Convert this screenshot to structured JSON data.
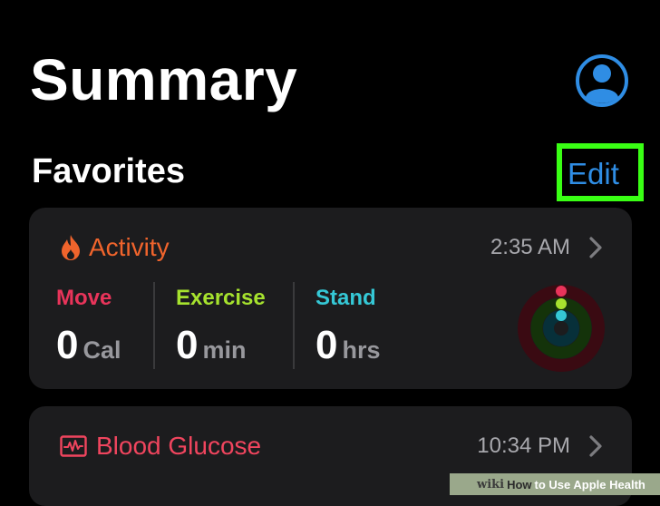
{
  "header": {
    "title": "Summary",
    "profile_icon": "person-circle-icon"
  },
  "favorites": {
    "title": "Favorites",
    "edit_label": "Edit",
    "highlight_color": "#39ff14"
  },
  "activity": {
    "icon": "flame-icon",
    "title": "Activity",
    "time": "2:35 AM",
    "accent_color": "#f0642c",
    "metrics": [
      {
        "label": "Move",
        "value": "0",
        "unit": "Cal",
        "color": "#e8345a"
      },
      {
        "label": "Exercise",
        "value": "0",
        "unit": "min",
        "color": "#a6e22e"
      },
      {
        "label": "Stand",
        "value": "0",
        "unit": "hrs",
        "color": "#35c8d6"
      }
    ],
    "rings_icon": "activity-rings-icon"
  },
  "blood_glucose": {
    "icon": "waveform-chart-icon",
    "title": "Blood Glucose",
    "time": "10:34 PM",
    "accent_color": "#f0455e"
  },
  "watermark": {
    "brand": "wiki",
    "how": "How",
    "rest": "to Use Apple Health"
  }
}
